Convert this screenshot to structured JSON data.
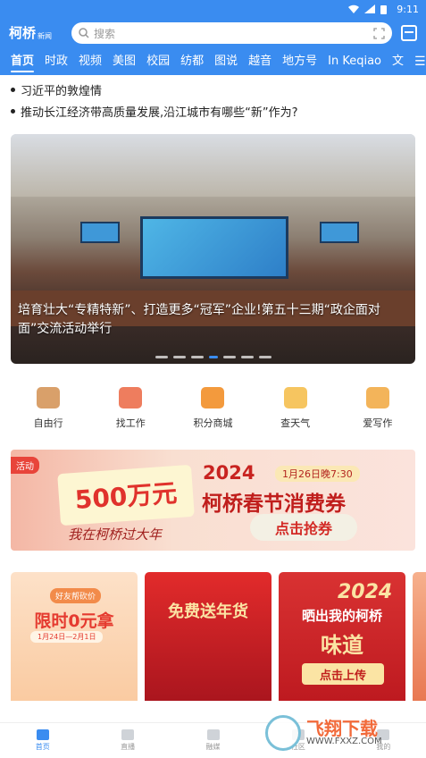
{
  "status": {
    "time": "9:11"
  },
  "header": {
    "logo": "柯桥",
    "logo_sub": "新闻",
    "search_placeholder": "搜索"
  },
  "tabs": [
    "首页",
    "时政",
    "视频",
    "美图",
    "校园",
    "纺都",
    "图说",
    "越音",
    "地方号",
    "In Keqiao",
    "文"
  ],
  "headlines": [
    "习近平的敦煌情",
    "推动长江经济带高质量发展,沿江城市有哪些“新”作为?"
  ],
  "banner": {
    "caption": "培育壮大“专精特新”、打造更多“冠军”企业!第五十三期“政企面对面”交流活动举行",
    "active_index": 3,
    "dot_count": 7
  },
  "quick_links": [
    "自由行",
    "找工作",
    "积分商城",
    "查天气",
    "爱写作"
  ],
  "quick_colors": [
    "#d9a06a",
    "#ee7d5e",
    "#f39a3d",
    "#f6c560",
    "#f3b45a"
  ],
  "promo": {
    "tag": "活动",
    "amount": "500万元",
    "slogan": "我在柯桥过大年",
    "year": "2024",
    "date": "1月26日晚7:30",
    "title": "柯桥春节消费券",
    "cta": "点击抢券"
  },
  "cards": {
    "card1": {
      "chip": "好友帮砍价",
      "big": "限时0元拿",
      "sub": "1月24日—2月1日"
    },
    "card2": {
      "big": "免费送年货"
    },
    "card3": {
      "yr": "2024",
      "big": "晒出我的柯桥",
      "mid": "味道",
      "btn": "点击上传"
    }
  },
  "tabbar": [
    "首页",
    "直播",
    "融媒",
    "社区",
    "我的"
  ],
  "watermark": {
    "title": "飞翔下载",
    "url": "WWW.FXXZ.COM"
  }
}
